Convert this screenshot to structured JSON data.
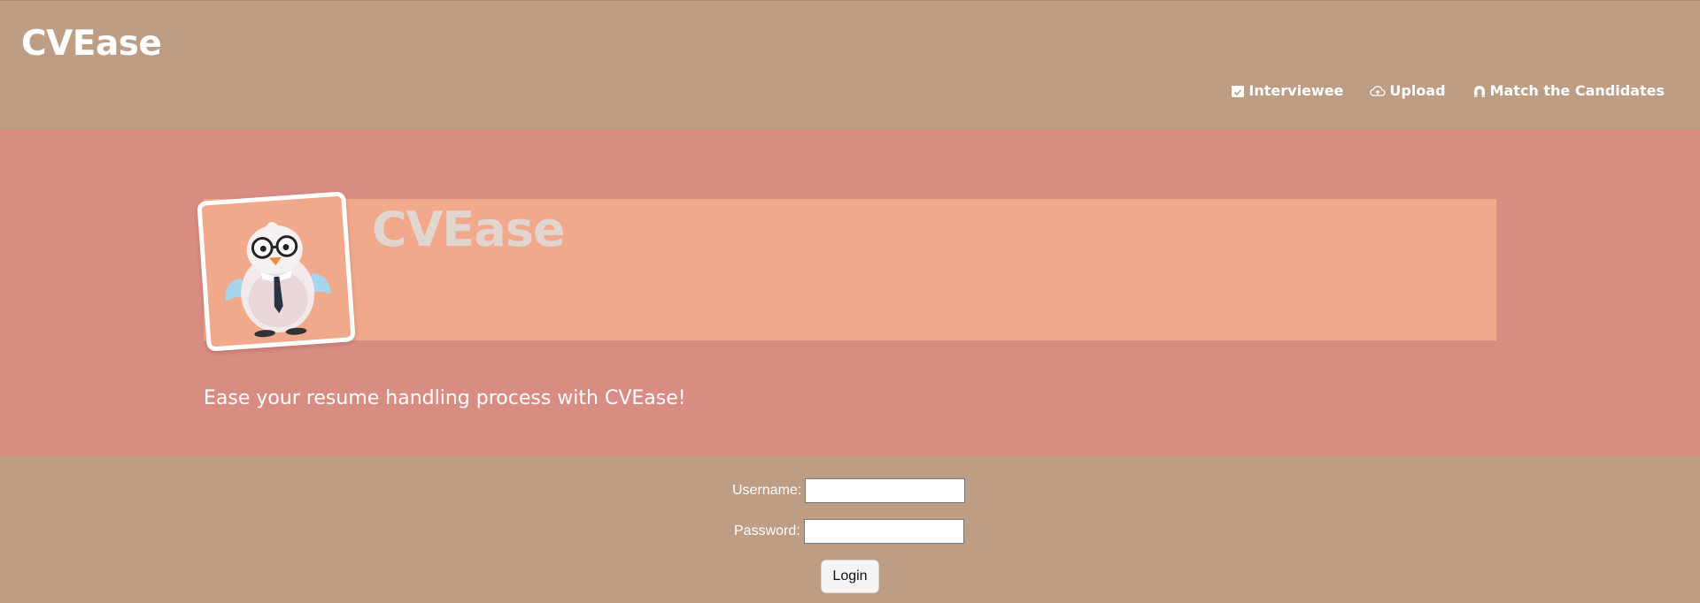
{
  "header": {
    "brand": "CVEase",
    "nav": [
      {
        "label": "Interviewee",
        "icon": "calendar-check-icon"
      },
      {
        "label": "Upload",
        "icon": "cloud-upload-icon"
      },
      {
        "label": "Match the Candidates",
        "icon": "magnet-icon"
      }
    ]
  },
  "hero": {
    "title": "CVEase",
    "tagline": "Ease your resume handling process with CVEase!",
    "logo": "bird-mascot-logo"
  },
  "login": {
    "username_label": "Username:",
    "username_value": "",
    "password_label": "Password:",
    "password_value": "",
    "submit_label": "Login"
  },
  "colors": {
    "header_bg": "#bd9d84",
    "hero_bg": "#d98c82",
    "hero_band": "#f2a88b",
    "text_light": "#ffffff"
  }
}
